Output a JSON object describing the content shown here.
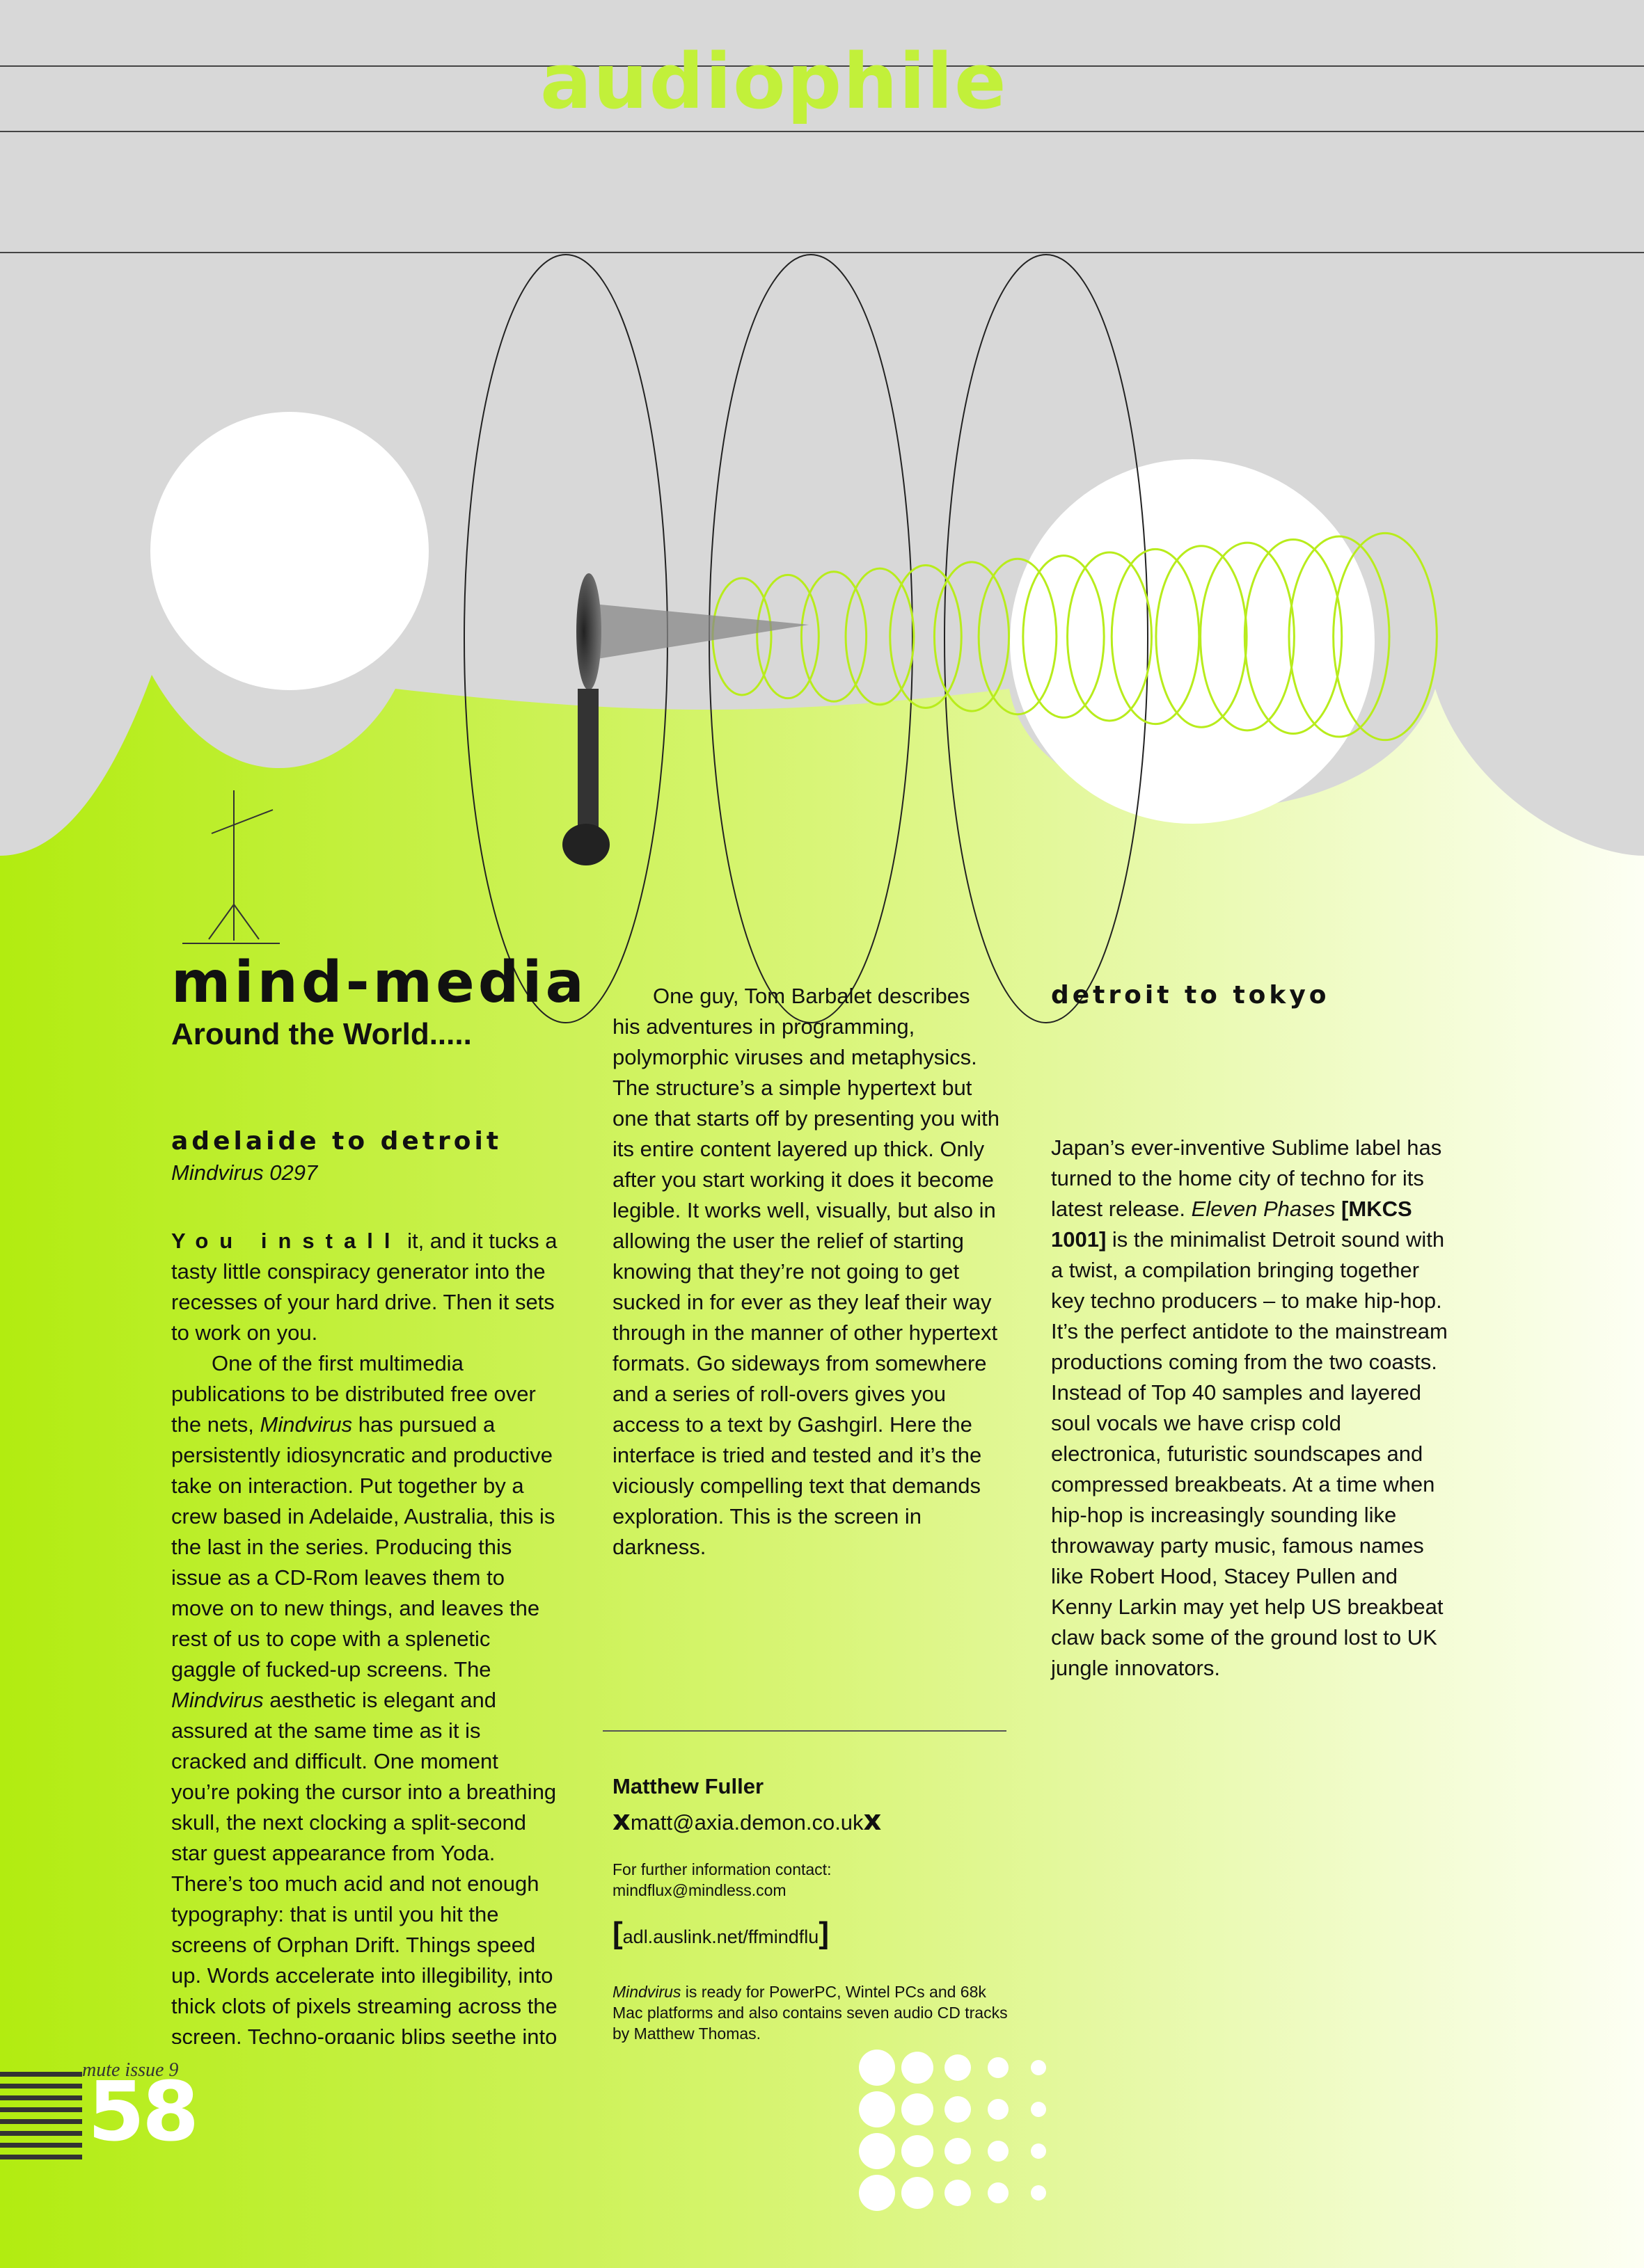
{
  "header": {
    "title": "audiophile"
  },
  "colors": {
    "lime": "#b6ee14",
    "grey": "#d8d8d8",
    "accent_text": "#c2f03a"
  },
  "article": {
    "title": "mind-media",
    "subtitle": "Around the World.....",
    "section1": {
      "heading": "adelaide to detroit",
      "item": "Mindvirus 0297",
      "lead": "You install",
      "p1_rest": " it, and it tucks a tasty little conspiracy generator into the recesses of your hard drive. Then it sets to work on you.",
      "p2_a": "One of the first multimedia publications to be distributed free over the nets, ",
      "p2_em1": "Mindvirus",
      "p2_b": " has pursued a persistently idiosyncratic and productive take on interaction. Put together by a crew based in Adelaide, Australia, this is the last in the series. Producing this issue as a CD-Rom leaves them to move on to new things, and leaves the rest of us to cope with a splenetic gaggle of fucked-up screens. The ",
      "p2_em2": "Mindvirus",
      "p2_c": " aesthetic is elegant and assured at the same time as it is cracked and difficult. One moment you’re poking the cursor into a breathing skull, the next clocking a split-second star guest appearance from Yoda. There’s too much acid and not enough typography: that is until you hit the screens of Orphan Drift. Things speed up. Words accelerate into illegibility, into thick clots of pixels streaming across the screen. Techno-organic blips seethe into view and dump you into texts by Nick Land, McKenzie Wark, Belinda Barnet and others.",
      "p3": "One guy, Tom Barbalet describes his adventures in programming, polymorphic viruses and metaphysics. The structure’s a simple hypertext but one that starts off by presenting you with its entire content layered up thick. Only after you start working it does it become legible. It works well, visually, but also in allowing the user the relief of starting knowing that they’re not going to get sucked in for ever as they leaf their way through in the manner of other hypertext formats. Go sideways from somewhere and a series of roll-overs gives you access to a text by Gashgirl. Here the interface is tried and tested and it’s the viciously compelling text that demands exploration. This is the screen in darkness."
    },
    "credit": {
      "author": "Matthew Fuller",
      "email": "matt@axia.demon.co.uk",
      "mark": "x",
      "contact_label": "For further information contact:",
      "contact_email": "mindflux@mindless.com",
      "url": "adl.auslink.net/ffmindflu",
      "note_em": "Mindvirus",
      "note_rest": " is ready for PowerPC, Wintel PCs and 68k Mac platforms and also contains seven audio CD tracks by Matthew Thomas."
    },
    "section2": {
      "heading": "detroit to tokyo",
      "p_a": "Japan’s ever-inventive Sublime label has turned to the home city of techno for its latest release. ",
      "p_em": "Eleven Phases",
      "p_code": "[MKCS 1001]",
      "p_b": " is the minimalist Detroit sound with a twist, a compilation bringing together key techno producers – to make hip-hop. It’s the perfect antidote to the mainstream productions coming from the two coasts. Instead of Top 40 samples and layered soul vocals we have crisp cold electronica, futuristic soundscapes and compressed breakbeats. At a time when hip-hop is increasingly sounding like throwaway party music, famous names like Robert Hood, Stacey Pullen and Kenny Larkin may yet help US breakbeat claw back some of the ground lost to UK jungle innovators."
    }
  },
  "footer": {
    "issue": "mute issue 9",
    "page": "58"
  }
}
